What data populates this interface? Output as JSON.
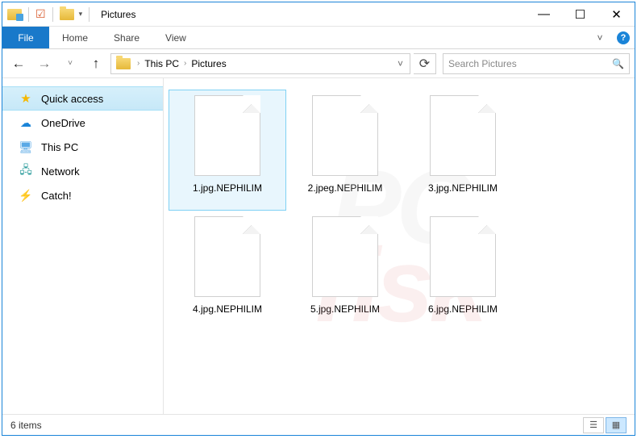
{
  "title": "Pictures",
  "ribbon": {
    "file": "File",
    "tabs": [
      "Home",
      "Share",
      "View"
    ]
  },
  "breadcrumb": {
    "root": "This PC",
    "current": "Pictures"
  },
  "search": {
    "placeholder": "Search Pictures"
  },
  "sidebar": {
    "items": [
      {
        "label": "Quick access"
      },
      {
        "label": "OneDrive"
      },
      {
        "label": "This PC"
      },
      {
        "label": "Network"
      },
      {
        "label": "Catch!"
      }
    ]
  },
  "files": [
    {
      "name": "1.jpg.NEPHILIM"
    },
    {
      "name": "2.jpeg.NEPHILIM"
    },
    {
      "name": "3.jpg.NEPHILIM"
    },
    {
      "name": "4.jpg.NEPHILIM"
    },
    {
      "name": "5.jpg.NEPHILIM"
    },
    {
      "name": "6.jpg.NEPHILIM"
    }
  ],
  "status": {
    "text": "6 items"
  },
  "watermark_line1": "PC",
  "watermark_line2": "risk"
}
